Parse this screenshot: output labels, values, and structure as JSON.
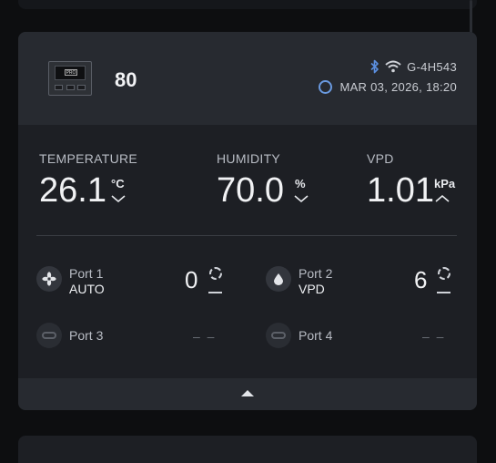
{
  "device": {
    "name": "80",
    "id": "G-4H543",
    "timestamp": "MAR 03, 2026, 18:20",
    "thumb_label": "PRO"
  },
  "metrics": [
    {
      "label": "TEMPERATURE",
      "value": "26.1",
      "unit": "°C",
      "trend": "down"
    },
    {
      "label": "HUMIDITY",
      "value": "70.0",
      "unit": "%",
      "trend": "down"
    },
    {
      "label": "VPD",
      "value": "1.01",
      "unit": "kPa",
      "trend": "up"
    }
  ],
  "ports": [
    {
      "name": "Port 1",
      "mode": "AUTO",
      "level": "0",
      "icon": "fan-icon"
    },
    {
      "name": "Port 2",
      "mode": "VPD",
      "level": "6",
      "icon": "humidifier-drop-icon"
    },
    {
      "name": "Port 3",
      "mode": "",
      "level": "– –",
      "icon": "unplugged-icon"
    },
    {
      "name": "Port 4",
      "mode": "",
      "level": "– –",
      "icon": "unplugged-icon"
    }
  ],
  "colors": {
    "accent_blue": "#6a9ae0",
    "card_bg": "#1d1f24",
    "header_bg": "#272a30",
    "page_bg": "#0d0e10"
  },
  "icons": {
    "bluetooth": "bluetooth-icon",
    "wifi": "wifi-icon",
    "clock": "clock-icon",
    "collapse": "chevron-up-icon"
  }
}
